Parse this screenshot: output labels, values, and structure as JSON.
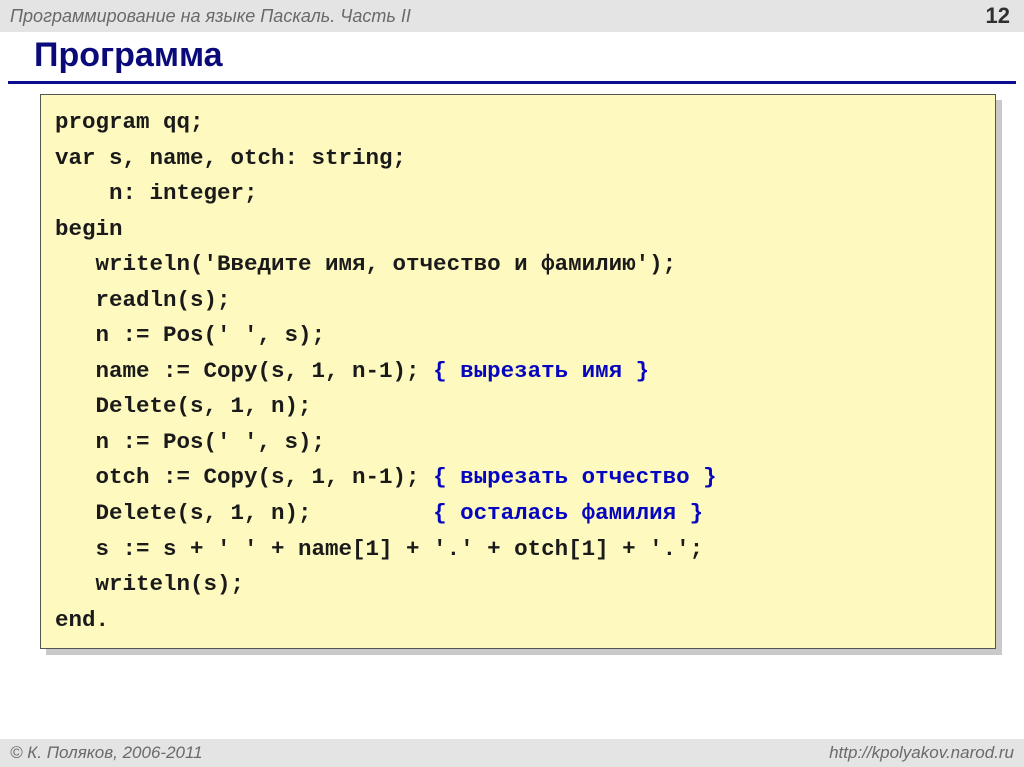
{
  "header": {
    "title": "Программирование на языке Паскаль. Часть II",
    "page_number": "12"
  },
  "title": "Программа",
  "code_lines": [
    {
      "indent": 0,
      "segments": [
        {
          "t": "program qq;",
          "c": "plain"
        }
      ]
    },
    {
      "indent": 0,
      "segments": [
        {
          "t": "var s, name, otch: string;",
          "c": "plain"
        }
      ]
    },
    {
      "indent": 0,
      "segments": [
        {
          "t": "    n: integer;",
          "c": "plain"
        }
      ]
    },
    {
      "indent": 0,
      "segments": [
        {
          "t": "begin",
          "c": "plain"
        }
      ]
    },
    {
      "indent": 1,
      "segments": [
        {
          "t": "writeln('Введите имя, отчество и фамилию');",
          "c": "plain"
        }
      ]
    },
    {
      "indent": 1,
      "segments": [
        {
          "t": "readln(s);",
          "c": "plain"
        }
      ]
    },
    {
      "indent": 1,
      "segments": [
        {
          "t": "n := Pos(' ', s);",
          "c": "plain"
        }
      ]
    },
    {
      "indent": 1,
      "segments": [
        {
          "t": "name := Copy(s, 1, n-1); ",
          "c": "plain"
        },
        {
          "t": "{ вырезать имя }",
          "c": "kw"
        }
      ]
    },
    {
      "indent": 1,
      "segments": [
        {
          "t": "Delete(s, 1, n);",
          "c": "plain"
        }
      ]
    },
    {
      "indent": 1,
      "segments": [
        {
          "t": "n := Pos(' ', s);",
          "c": "plain"
        }
      ]
    },
    {
      "indent": 1,
      "segments": [
        {
          "t": "otch := Copy(s, 1, n-1); ",
          "c": "plain"
        },
        {
          "t": "{ вырезать отчество }",
          "c": "kw"
        }
      ]
    },
    {
      "indent": 1,
      "segments": [
        {
          "t": "Delete(s, 1, n);         ",
          "c": "plain"
        },
        {
          "t": "{ осталась фамилия }",
          "c": "kw"
        }
      ]
    },
    {
      "indent": 1,
      "segments": [
        {
          "t": "s := s + ' ' + name[1] + '.' + otch[1] + '.';",
          "c": "plain"
        }
      ]
    },
    {
      "indent": 1,
      "segments": [
        {
          "t": "writeln(s);",
          "c": "plain"
        }
      ]
    },
    {
      "indent": 0,
      "segments": [
        {
          "t": "end.",
          "c": "plain"
        }
      ]
    }
  ],
  "footer": {
    "left": "© К. Поляков, 2006-2011",
    "right": "http://kpolyakov.narod.ru"
  }
}
